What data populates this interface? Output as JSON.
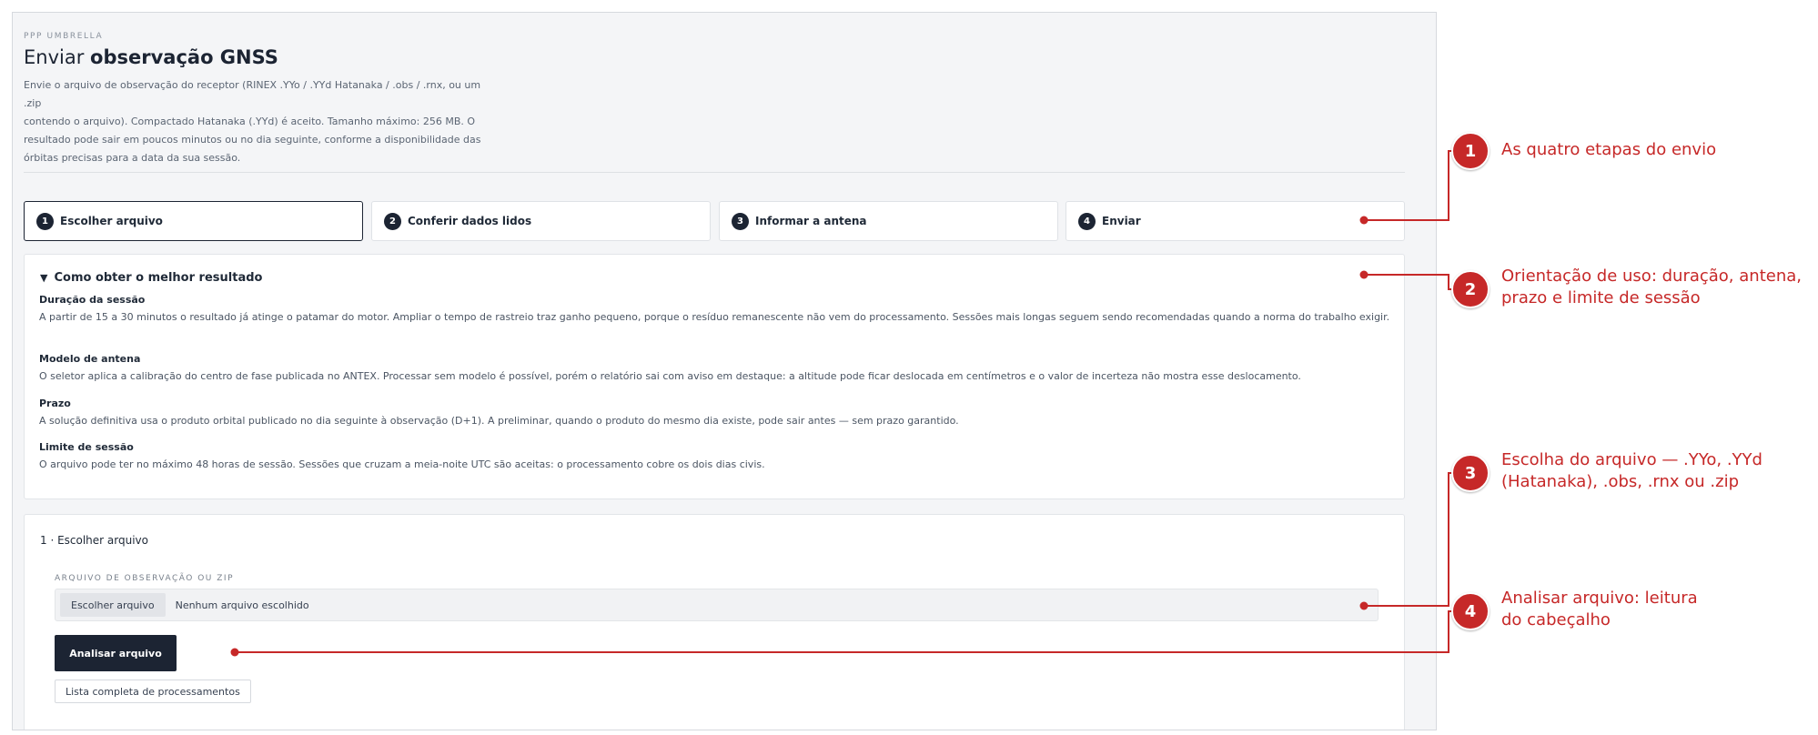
{
  "header": {
    "eyebrow": "PPP UMBRELLA",
    "title_prefix": "Enviar ",
    "title_bold": "observação GNSS",
    "intro_lines": [
      "Envie o arquivo de observação do receptor (RINEX .YYo / .YYd Hatanaka / .obs / .rnx, ou um .zip",
      "contendo o arquivo). Compactado Hatanaka (.YYd) é aceito. Tamanho máximo: 256 MB. O",
      "resultado pode sair em poucos minutos ou no dia seguinte, conforme a disponibilidade das",
      "órbitas precisas para a data da sua sessão."
    ]
  },
  "steps": [
    {
      "num": "1",
      "label": "Escolher arquivo",
      "active": true
    },
    {
      "num": "2",
      "label": "Conferir dados lidos",
      "active": false
    },
    {
      "num": "3",
      "label": "Informar a antena",
      "active": false
    },
    {
      "num": "4",
      "label": "Enviar",
      "active": false
    }
  ],
  "guide": {
    "toggle_icon": "▼",
    "summary": "Como obter o melhor resultado",
    "items": [
      {
        "heading": "Duração da sessão",
        "body": "A partir de 15 a 30 minutos o resultado já atinge o patamar do motor. Ampliar o tempo de rastreio traz ganho pequeno, porque o resíduo remanescente não vem do processamento. Sessões mais longas seguem sendo recomendadas quando a norma do trabalho exigir."
      },
      {
        "heading": "Modelo de antena",
        "body": "O seletor aplica a calibração do centro de fase publicada no ANTEX. Processar sem modelo é possível, porém o relatório sai com aviso em destaque: a altitude pode ficar deslocada em centímetros e o valor de incerteza não mostra esse deslocamento."
      },
      {
        "heading": "Prazo",
        "body": "A solução definitiva usa o produto orbital publicado no dia seguinte à observação (D+1). A preliminar, quando o produto do mesmo dia existe, pode sair antes — sem prazo garantido."
      },
      {
        "heading": "Limite de sessão",
        "body": "O arquivo pode ter no máximo 48 horas de sessão. Sessões que cruzam a meia-noite UTC são aceitas: o processamento cobre os dois dias civis."
      }
    ]
  },
  "file_section": {
    "title": "1 · Escolher arquivo",
    "field_label": "ARQUIVO DE OBSERVAÇÃO OU ZIP",
    "choose_button": "Escolher arquivo",
    "no_file_text": "Nenhum arquivo escolhido",
    "analyze_button": "Analisar arquivo",
    "list_link": "Lista completa de processamentos"
  },
  "callouts": [
    {
      "num": "1",
      "text": "As quatro etapas do envio"
    },
    {
      "num": "2",
      "text": "Orientação de uso: duração, antena, prazo e limite de sessão"
    },
    {
      "num": "3",
      "text": "Escolha do arquivo — .YYo, .YYd (Hatanaka), .obs, .rnx ou .zip"
    },
    {
      "num": "4",
      "text": "Analisar arquivo: leitura do cabeçalho"
    }
  ],
  "colors": {
    "accent": "#1c2433",
    "callout": "#c62828",
    "page_bg": "#f4f5f7"
  }
}
